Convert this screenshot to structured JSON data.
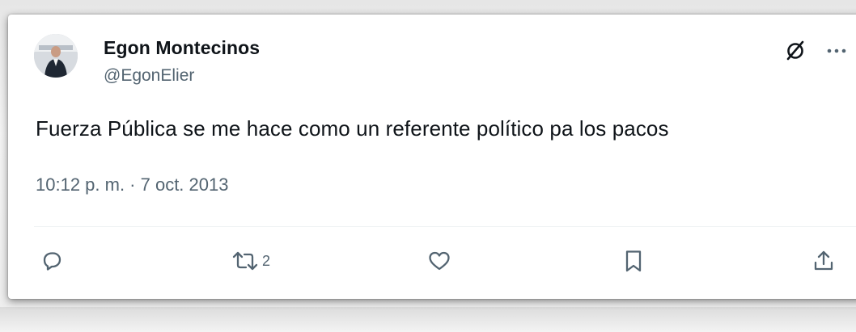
{
  "tweet": {
    "author": {
      "name": "Egon Montecinos",
      "handle": "@EgonElier"
    },
    "text": "Fuerza Pública se me hace como un referente político pa los pacos",
    "timestamp": "10:12 p. m. · 7 oct. 2013",
    "actions": {
      "reply_count": "",
      "retweet_count": "2",
      "like_count": "",
      "bookmark_count": ""
    }
  },
  "icons": {
    "header": [
      "grok-icon",
      "more-icon"
    ],
    "actions": [
      "reply-icon",
      "retweet-icon",
      "like-icon",
      "bookmark-icon",
      "share-icon"
    ]
  },
  "colors": {
    "text_primary": "#0f1419",
    "text_secondary": "#536471",
    "divider": "#eff3f4",
    "card_background": "#ffffff"
  }
}
